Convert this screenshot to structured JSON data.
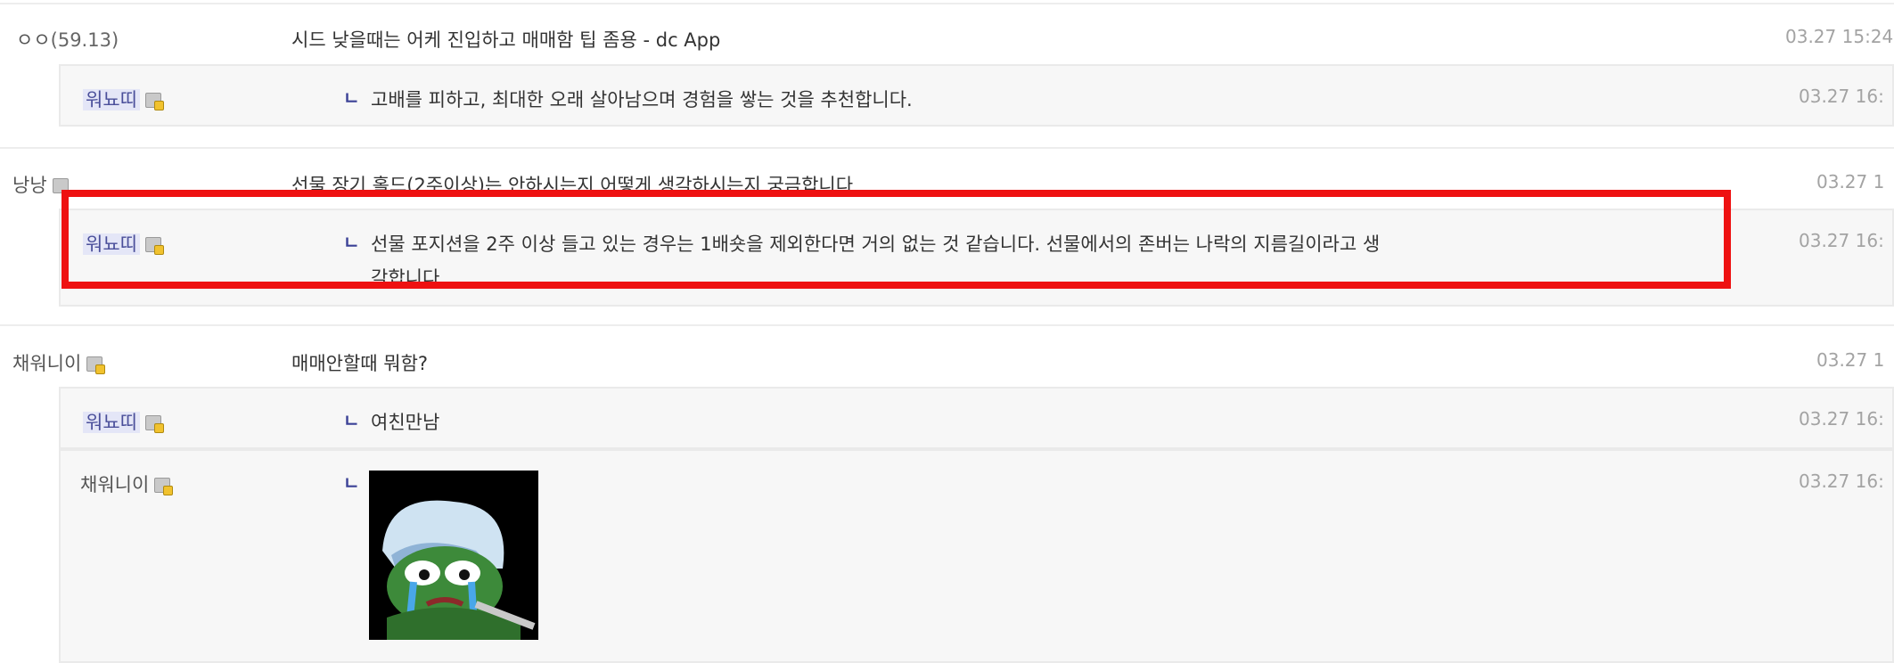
{
  "comments": [
    {
      "nick": "ㅇㅇ",
      "ip": "(59.13)",
      "text": "시드 낮을때는 어케 진입하고 매매함 팁 좀용 - dc App",
      "date": "03.27 15:24"
    },
    {
      "nick": "워뇨띠",
      "text": "고배를 피하고, 최대한 오래 살아남으며 경험을 쌓는 것을 추천합니다.",
      "date": "03.27 16:",
      "reply": true
    },
    {
      "nick": "낭낭",
      "text": "선물 장기 홀드(2주이상)는 안하시는지 어떻게 생각하시는지 궁금합니다",
      "date": "03.27 1"
    },
    {
      "nick": "워뇨띠",
      "text_line1": "선물 포지션을 2주 이상 들고 있는 경우는 1배숏을 제외한다면 거의 없는 것 같습니다. 선물에서의 존버는 나락의 지름길이라고 생",
      "text_line2": "각합니다.",
      "date": "03.27 16:",
      "reply": true
    },
    {
      "nick": "채워니이",
      "text": "매매안할때 뭐함?",
      "date": "03.27 1"
    },
    {
      "nick": "워뇨띠",
      "text": "여친만남",
      "date": "03.27 16:",
      "reply": true
    },
    {
      "nick": "채워니이",
      "text": "",
      "date": "03.27 16:",
      "reply": true,
      "sticker": "crying-pepe-frog-sticker"
    }
  ],
  "icons": {
    "reply_arrow": "ㄴ",
    "user_icon": "gallog-icon"
  },
  "colors": {
    "highlight_border": "#ee1111",
    "reply_arrow": "#3b4196",
    "nick_highlight": "#e4e6f7"
  }
}
